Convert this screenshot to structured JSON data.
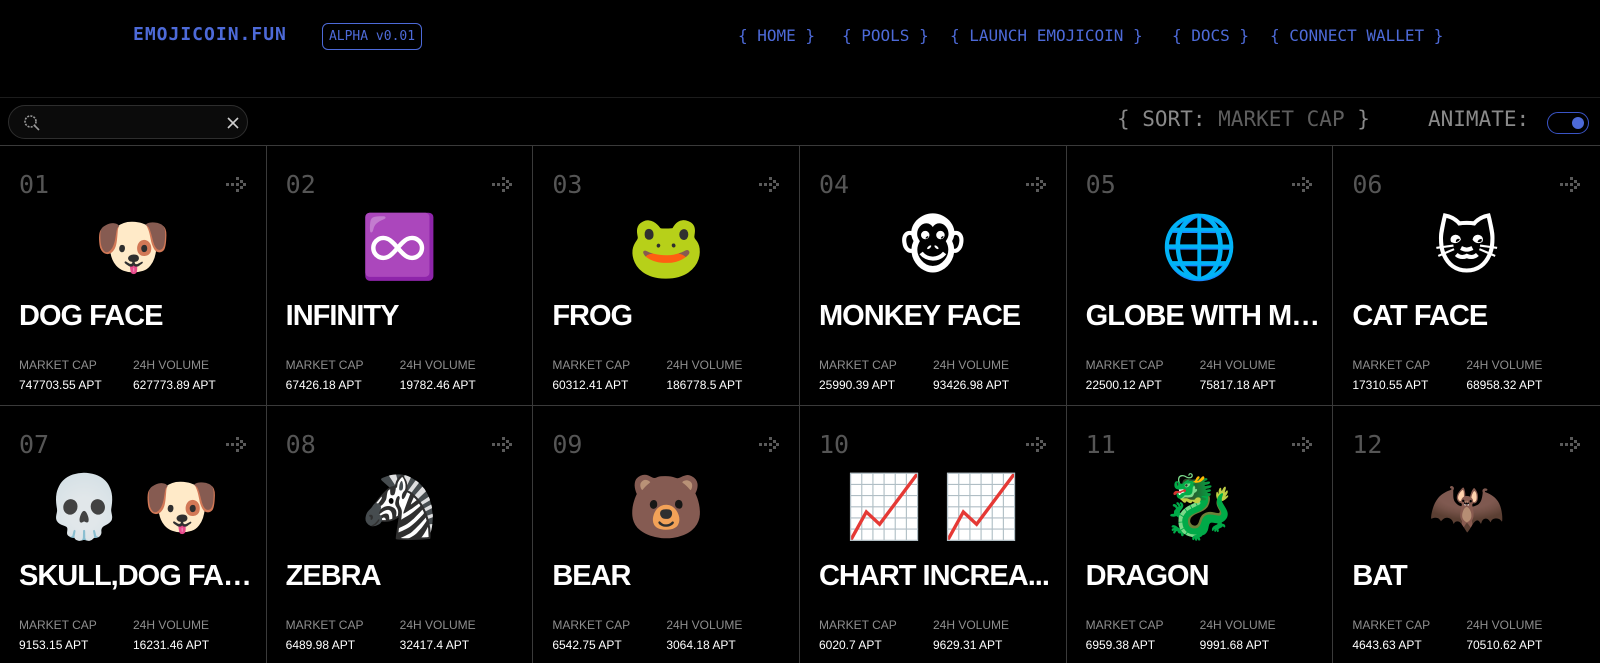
{
  "header": {
    "logo": "EMOJICOIN.FUN",
    "version": "ALPHA v0.01",
    "nav": [
      "{ HOME }",
      "{ POOLS }",
      "{ LAUNCH EMOJICOIN }",
      "{ DOCS }",
      "{ CONNECT WALLET }"
    ]
  },
  "toolbar": {
    "search_value": "",
    "sort_prefix": "{ SORT: ",
    "sort_value": "MARKET CAP",
    "sort_suffix": " }",
    "animate_label": "ANIMATE:",
    "animate_on": true
  },
  "labels": {
    "market_cap": "MARKET CAP",
    "volume": "24H VOLUME"
  },
  "colors": {
    "accent": "#4d6ad8",
    "background": "#000000",
    "border": "#3a3a3a"
  },
  "coins": [
    {
      "rank": "01",
      "emoji": "🐶",
      "name": "DOG FACE",
      "market_cap": "747703.55 APT",
      "volume": "627773.89 APT"
    },
    {
      "rank": "02",
      "emoji": "♾️",
      "name": "INFINITY",
      "market_cap": "67426.18 APT",
      "volume": "19782.46 APT"
    },
    {
      "rank": "03",
      "emoji": "🐸",
      "name": "FROG",
      "market_cap": "60312.41 APT",
      "volume": "186778.5 APT"
    },
    {
      "rank": "04",
      "emoji": "🐵",
      "name": "MONKEY FACE",
      "market_cap": "25990.39 APT",
      "volume": "93426.98 APT"
    },
    {
      "rank": "05",
      "emoji": "🌐",
      "name": "GLOBE WITH ME...",
      "market_cap": "22500.12 APT",
      "volume": "75817.18 APT"
    },
    {
      "rank": "06",
      "emoji": "🐱",
      "name": "CAT FACE",
      "market_cap": "17310.55 APT",
      "volume": "68958.32 APT"
    },
    {
      "rank": "07",
      "emoji": "💀 🐶",
      "name": "SKULL,DOG FACE",
      "market_cap": "9153.15 APT",
      "volume": "16231.46 APT"
    },
    {
      "rank": "08",
      "emoji": "🦓",
      "name": "ZEBRA",
      "market_cap": "6489.98 APT",
      "volume": "32417.4 APT"
    },
    {
      "rank": "09",
      "emoji": "🐻",
      "name": "BEAR",
      "market_cap": "6542.75 APT",
      "volume": "3064.18 APT"
    },
    {
      "rank": "10",
      "emoji": "📈 📈",
      "name": "CHART INCREA...",
      "market_cap": "6020.7 APT",
      "volume": "9629.31 APT"
    },
    {
      "rank": "11",
      "emoji": "🐉",
      "name": "DRAGON",
      "market_cap": "6959.38 APT",
      "volume": "9991.68 APT"
    },
    {
      "rank": "12",
      "emoji": "🦇",
      "name": "BAT",
      "market_cap": "4643.63 APT",
      "volume": "70510.62 APT"
    }
  ]
}
